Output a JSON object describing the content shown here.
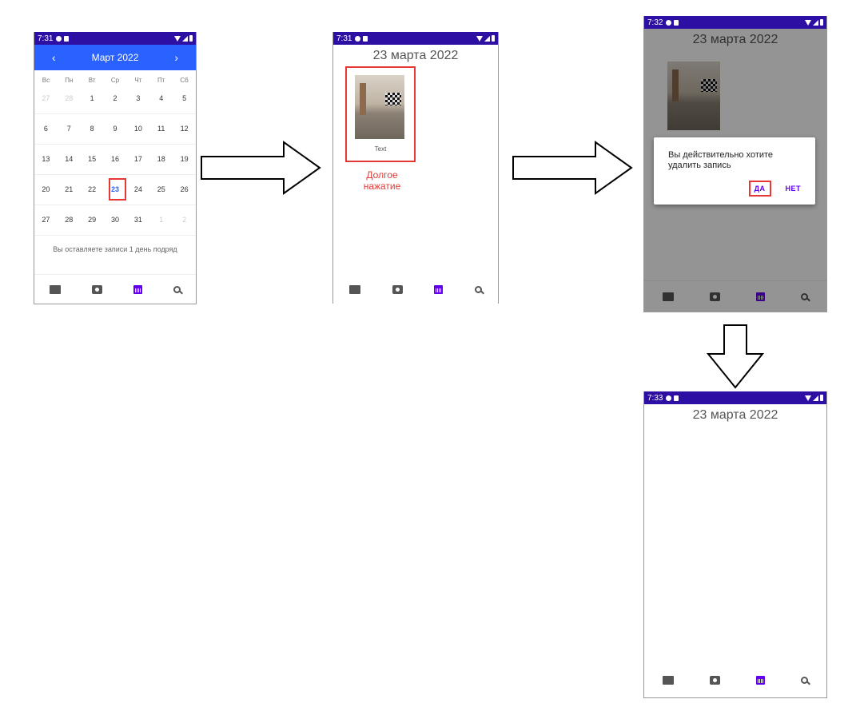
{
  "status_times": [
    "7:31",
    "7:31",
    "7:32",
    "7:33"
  ],
  "calendar": {
    "month_label": "Март  2022",
    "prev": "‹",
    "next": "›",
    "weekdays": [
      "Вс",
      "Пн",
      "Вт",
      "Ср",
      "Чт",
      "Пт",
      "Сб"
    ],
    "days": [
      [
        "27",
        "28",
        "1",
        "2",
        "3",
        "4",
        "5"
      ],
      [
        "6",
        "7",
        "8",
        "9",
        "10",
        "11",
        "12"
      ],
      [
        "13",
        "14",
        "15",
        "16",
        "17",
        "18",
        "19"
      ],
      [
        "20",
        "21",
        "22",
        "23",
        "24",
        "25",
        "26"
      ],
      [
        "27",
        "28",
        "29",
        "30",
        "31",
        "1",
        "2"
      ]
    ],
    "muted": [
      [
        0,
        0
      ],
      [
        0,
        1
      ],
      [
        4,
        5
      ],
      [
        4,
        6
      ]
    ],
    "selected": [
      3,
      3
    ],
    "streak_text": "Вы оставляете записи 1 день подряд"
  },
  "day_view": {
    "date_title": "23 марта 2022",
    "entry_text": "Text",
    "long_press_label_1": "Долгое",
    "long_press_label_2": "нажатие"
  },
  "dialog": {
    "message_line1": "Вы действительно хотите",
    "message_line2": "удалить запись",
    "yes": "ДА",
    "no": "НЕТ"
  },
  "nav_icons": [
    "gallery-icon",
    "camera-icon",
    "calendar-icon",
    "search-icon"
  ],
  "colors": {
    "status_bar": "#2e0fa3",
    "header": "#2962ff",
    "accent": "#6200ee",
    "highlight": "#e53935"
  }
}
